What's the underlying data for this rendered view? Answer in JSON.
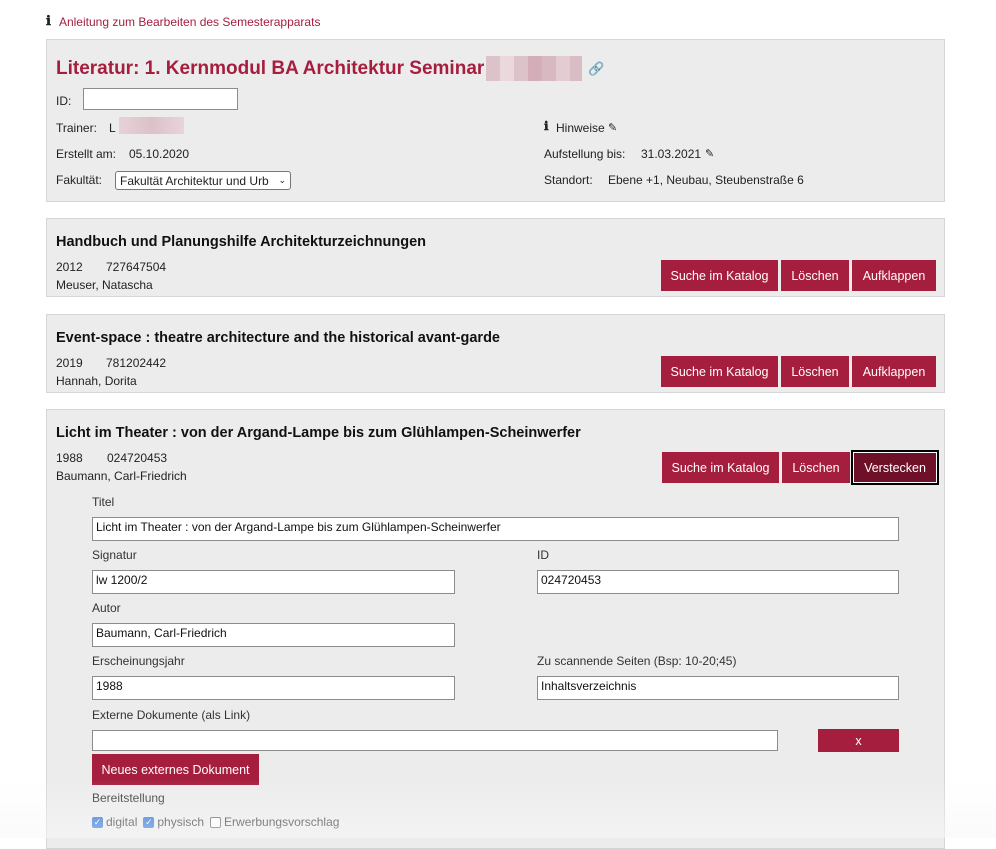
{
  "help": {
    "icon": "info-icon",
    "text": "Anleitung zum Bearbeiten des Semesterapparats"
  },
  "header": {
    "title": "Literatur: 1. Kernmodul BA Architektur Seminar",
    "id_label": "ID:",
    "id_value": "",
    "trainer_label": "Trainer:",
    "trainer_value": "L",
    "created_label": "Erstellt am:",
    "created_value": "05.10.2020",
    "faculty_label": "Fakultät:",
    "faculty_value": "Fakultät Architektur und Urb",
    "hints_label": "Hinweise",
    "setup_label": "Aufstellung bis:",
    "setup_value": "31.03.2021",
    "location_label": "Standort:",
    "location_value": "Ebene +1, Neubau, Steubenstraße 6"
  },
  "books": [
    {
      "title": "Handbuch und Planungshilfe Architekturzeichnungen",
      "year": "2012",
      "id": "727647504",
      "author": "Meuser, Natascha",
      "btn_search": "Suche im Katalog",
      "btn_delete": "Löschen",
      "btn_toggle": "Aufklappen"
    },
    {
      "title": "Event-space : theatre architecture and the historical avant-garde",
      "year": "2019",
      "id": "781202442",
      "author": "Hannah, Dorita",
      "btn_search": "Suche im Katalog",
      "btn_delete": "Löschen",
      "btn_toggle": "Aufklappen"
    },
    {
      "title": "Licht im Theater : von der Argand-Lampe bis zum Glühlampen-Scheinwerfer",
      "year": "1988",
      "id": "024720453",
      "author": "Baumann, Carl-Friedrich",
      "btn_search": "Suche im Katalog",
      "btn_delete": "Löschen",
      "btn_toggle": "Verstecken"
    }
  ],
  "form": {
    "title_label": "Titel",
    "title_value": "Licht im Theater : von der Argand-Lampe bis zum Glühlampen-Scheinwerfer",
    "signatur_label": "Signatur",
    "signatur_value": "lw 1200/2",
    "id_label": "ID",
    "id_value": "024720453",
    "author_label": "Autor",
    "author_value": "Baumann, Carl-Friedrich",
    "year_label": "Erscheinungsjahr",
    "year_value": "1988",
    "pages_label": "Zu scannende Seiten (Bsp: 10-20;45)",
    "pages_value": "Inhaltsverzeichnis",
    "ext_label": "Externe Dokumente (als Link)",
    "ext_value": "",
    "remove_label": "x",
    "new_doc_label": "Neues externes Dokument",
    "provision_label": "Bereitstellung",
    "opt_digital": "digital",
    "opt_physical": "physisch",
    "opt_acquisition": "Erwerbungsvorschlag",
    "digital_checked": true,
    "physical_checked": true,
    "acquisition_checked": false
  },
  "colors": {
    "accent": "#a61e3e",
    "panel": "#ececec"
  }
}
